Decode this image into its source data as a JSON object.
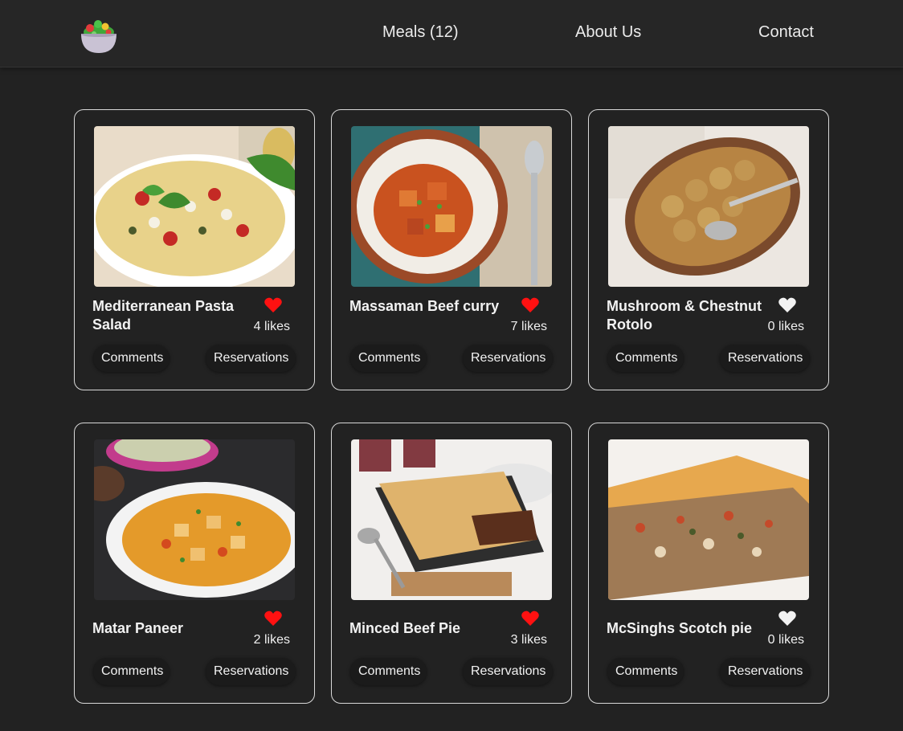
{
  "header": {
    "logo_icon": "salad-bowl-icon",
    "nav": [
      {
        "label": "Meals (12)"
      },
      {
        "label": "About Us"
      },
      {
        "label": "Contact"
      }
    ]
  },
  "meals": [
    {
      "title": "Mediterranean Pasta Salad",
      "likes_text": "4 likes",
      "liked": true,
      "image": "pasta-salad-image"
    },
    {
      "title": "Massaman Beef curry",
      "likes_text": "7 likes",
      "liked": true,
      "image": "beef-curry-image"
    },
    {
      "title": "Mushroom & Chestnut Rotolo",
      "likes_text": "0 likes",
      "liked": false,
      "image": "rotolo-image"
    },
    {
      "title": "Matar Paneer",
      "likes_text": "2 likes",
      "liked": true,
      "image": "matar-paneer-image"
    },
    {
      "title": "Minced Beef Pie",
      "likes_text": "3 likes",
      "liked": true,
      "image": "beef-pie-image"
    },
    {
      "title": "McSinghs Scotch pie",
      "likes_text": "0 likes",
      "liked": false,
      "image": "scotch-pie-image"
    }
  ],
  "buttons": {
    "comments": "Comments",
    "reservations": "Reservations"
  },
  "colors": {
    "background": "#222222",
    "header": "#262626",
    "heart_liked": "#ff1111",
    "heart_unliked": "#f2f2f2",
    "card_border": "#d9d9d9"
  }
}
